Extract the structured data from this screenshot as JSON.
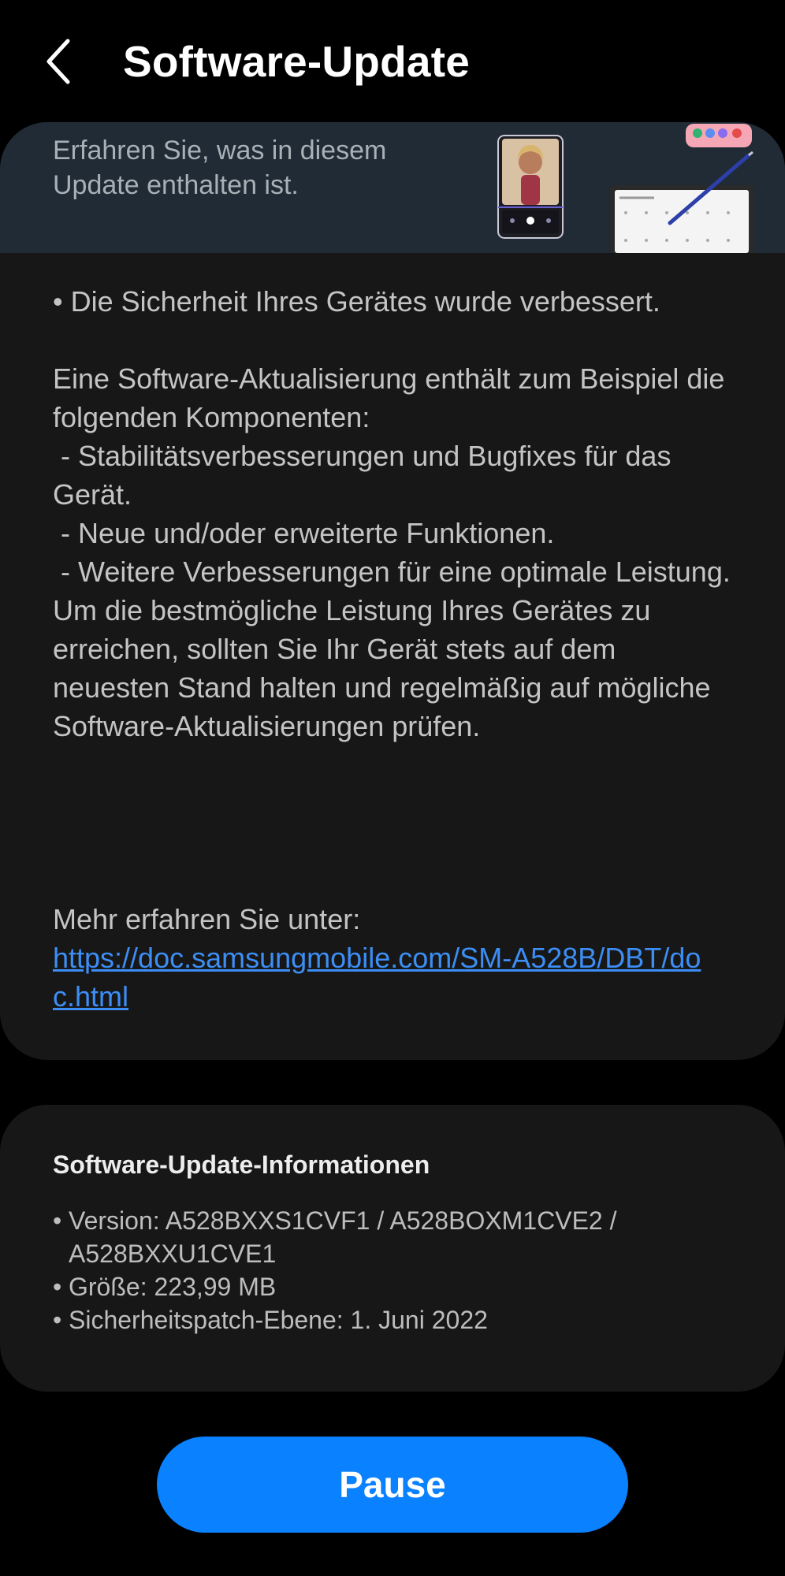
{
  "header": {
    "title": "Software-Update"
  },
  "banner": {
    "text": "Erfahren Sie, was in diesem Update enthalten ist."
  },
  "release_notes": {
    "text": "• Die Sicherheit Ihres Gerätes wurde verbessert.\n\nEine Software-Aktualisierung enthält zum Beispiel die folgenden Komponenten:\n - Stabilitätsverbesserungen und Bugfixes für das Gerät.\n - Neue und/oder erweiterte Funktionen.\n - Weitere Verbesserungen für eine optimale Leistung.\nUm die bestmögliche Leistung Ihres Gerätes zu erreichen, sollten Sie Ihr Gerät stets auf dem neuesten Stand halten und regelmäßig auf mögliche Software-Aktualisierungen prüfen.",
    "more_label": "Mehr erfahren Sie unter:",
    "link": "https://doc.samsungmobile.com/SM-A528B/DBT/doc.html"
  },
  "update_info": {
    "title": "Software-Update-Informationen",
    "items": [
      "Version: A528BXXS1CVF1 / A528BOXM1CVE2 / A528BXXU1CVE1",
      "Größe: 223,99 MB",
      "Sicherheitspatch-Ebene: 1. Juni 2022"
    ]
  },
  "actions": {
    "pause_label": "Pause"
  },
  "icons": {
    "back": "chevron-left-icon"
  },
  "colors": {
    "background": "#000000",
    "card": "#171717",
    "banner": "#202b36",
    "link": "#3c8ef5",
    "button": "#0a81ff"
  }
}
